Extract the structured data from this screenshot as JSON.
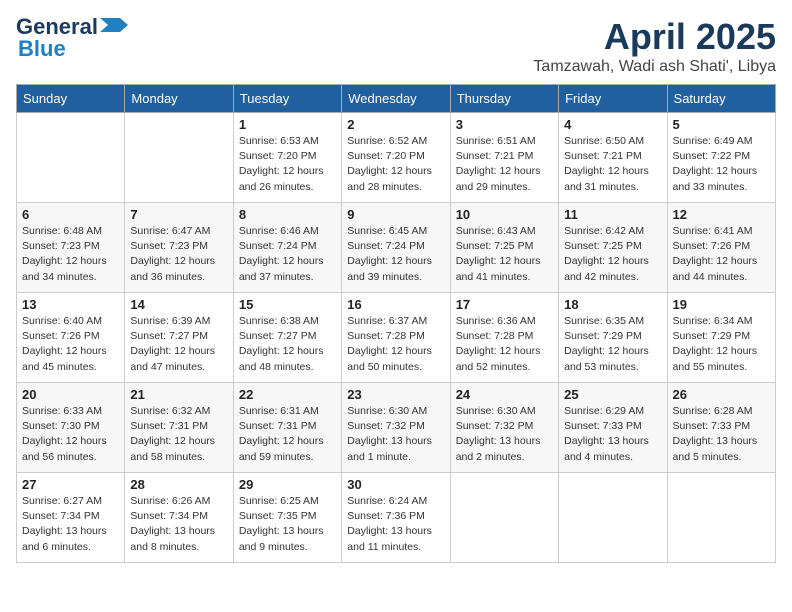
{
  "header": {
    "logo_line1": "General",
    "logo_line2": "Blue",
    "month": "April 2025",
    "location": "Tamzawah, Wadi ash Shati', Libya"
  },
  "weekdays": [
    "Sunday",
    "Monday",
    "Tuesday",
    "Wednesday",
    "Thursday",
    "Friday",
    "Saturday"
  ],
  "weeks": [
    [
      {
        "day": "",
        "info": ""
      },
      {
        "day": "",
        "info": ""
      },
      {
        "day": "1",
        "info": "Sunrise: 6:53 AM\nSunset: 7:20 PM\nDaylight: 12 hours and 26 minutes."
      },
      {
        "day": "2",
        "info": "Sunrise: 6:52 AM\nSunset: 7:20 PM\nDaylight: 12 hours and 28 minutes."
      },
      {
        "day": "3",
        "info": "Sunrise: 6:51 AM\nSunset: 7:21 PM\nDaylight: 12 hours and 29 minutes."
      },
      {
        "day": "4",
        "info": "Sunrise: 6:50 AM\nSunset: 7:21 PM\nDaylight: 12 hours and 31 minutes."
      },
      {
        "day": "5",
        "info": "Sunrise: 6:49 AM\nSunset: 7:22 PM\nDaylight: 12 hours and 33 minutes."
      }
    ],
    [
      {
        "day": "6",
        "info": "Sunrise: 6:48 AM\nSunset: 7:23 PM\nDaylight: 12 hours and 34 minutes."
      },
      {
        "day": "7",
        "info": "Sunrise: 6:47 AM\nSunset: 7:23 PM\nDaylight: 12 hours and 36 minutes."
      },
      {
        "day": "8",
        "info": "Sunrise: 6:46 AM\nSunset: 7:24 PM\nDaylight: 12 hours and 37 minutes."
      },
      {
        "day": "9",
        "info": "Sunrise: 6:45 AM\nSunset: 7:24 PM\nDaylight: 12 hours and 39 minutes."
      },
      {
        "day": "10",
        "info": "Sunrise: 6:43 AM\nSunset: 7:25 PM\nDaylight: 12 hours and 41 minutes."
      },
      {
        "day": "11",
        "info": "Sunrise: 6:42 AM\nSunset: 7:25 PM\nDaylight: 12 hours and 42 minutes."
      },
      {
        "day": "12",
        "info": "Sunrise: 6:41 AM\nSunset: 7:26 PM\nDaylight: 12 hours and 44 minutes."
      }
    ],
    [
      {
        "day": "13",
        "info": "Sunrise: 6:40 AM\nSunset: 7:26 PM\nDaylight: 12 hours and 45 minutes."
      },
      {
        "day": "14",
        "info": "Sunrise: 6:39 AM\nSunset: 7:27 PM\nDaylight: 12 hours and 47 minutes."
      },
      {
        "day": "15",
        "info": "Sunrise: 6:38 AM\nSunset: 7:27 PM\nDaylight: 12 hours and 48 minutes."
      },
      {
        "day": "16",
        "info": "Sunrise: 6:37 AM\nSunset: 7:28 PM\nDaylight: 12 hours and 50 minutes."
      },
      {
        "day": "17",
        "info": "Sunrise: 6:36 AM\nSunset: 7:28 PM\nDaylight: 12 hours and 52 minutes."
      },
      {
        "day": "18",
        "info": "Sunrise: 6:35 AM\nSunset: 7:29 PM\nDaylight: 12 hours and 53 minutes."
      },
      {
        "day": "19",
        "info": "Sunrise: 6:34 AM\nSunset: 7:29 PM\nDaylight: 12 hours and 55 minutes."
      }
    ],
    [
      {
        "day": "20",
        "info": "Sunrise: 6:33 AM\nSunset: 7:30 PM\nDaylight: 12 hours and 56 minutes."
      },
      {
        "day": "21",
        "info": "Sunrise: 6:32 AM\nSunset: 7:31 PM\nDaylight: 12 hours and 58 minutes."
      },
      {
        "day": "22",
        "info": "Sunrise: 6:31 AM\nSunset: 7:31 PM\nDaylight: 12 hours and 59 minutes."
      },
      {
        "day": "23",
        "info": "Sunrise: 6:30 AM\nSunset: 7:32 PM\nDaylight: 13 hours and 1 minute."
      },
      {
        "day": "24",
        "info": "Sunrise: 6:30 AM\nSunset: 7:32 PM\nDaylight: 13 hours and 2 minutes."
      },
      {
        "day": "25",
        "info": "Sunrise: 6:29 AM\nSunset: 7:33 PM\nDaylight: 13 hours and 4 minutes."
      },
      {
        "day": "26",
        "info": "Sunrise: 6:28 AM\nSunset: 7:33 PM\nDaylight: 13 hours and 5 minutes."
      }
    ],
    [
      {
        "day": "27",
        "info": "Sunrise: 6:27 AM\nSunset: 7:34 PM\nDaylight: 13 hours and 6 minutes."
      },
      {
        "day": "28",
        "info": "Sunrise: 6:26 AM\nSunset: 7:34 PM\nDaylight: 13 hours and 8 minutes."
      },
      {
        "day": "29",
        "info": "Sunrise: 6:25 AM\nSunset: 7:35 PM\nDaylight: 13 hours and 9 minutes."
      },
      {
        "day": "30",
        "info": "Sunrise: 6:24 AM\nSunset: 7:36 PM\nDaylight: 13 hours and 11 minutes."
      },
      {
        "day": "",
        "info": ""
      },
      {
        "day": "",
        "info": ""
      },
      {
        "day": "",
        "info": ""
      }
    ]
  ]
}
